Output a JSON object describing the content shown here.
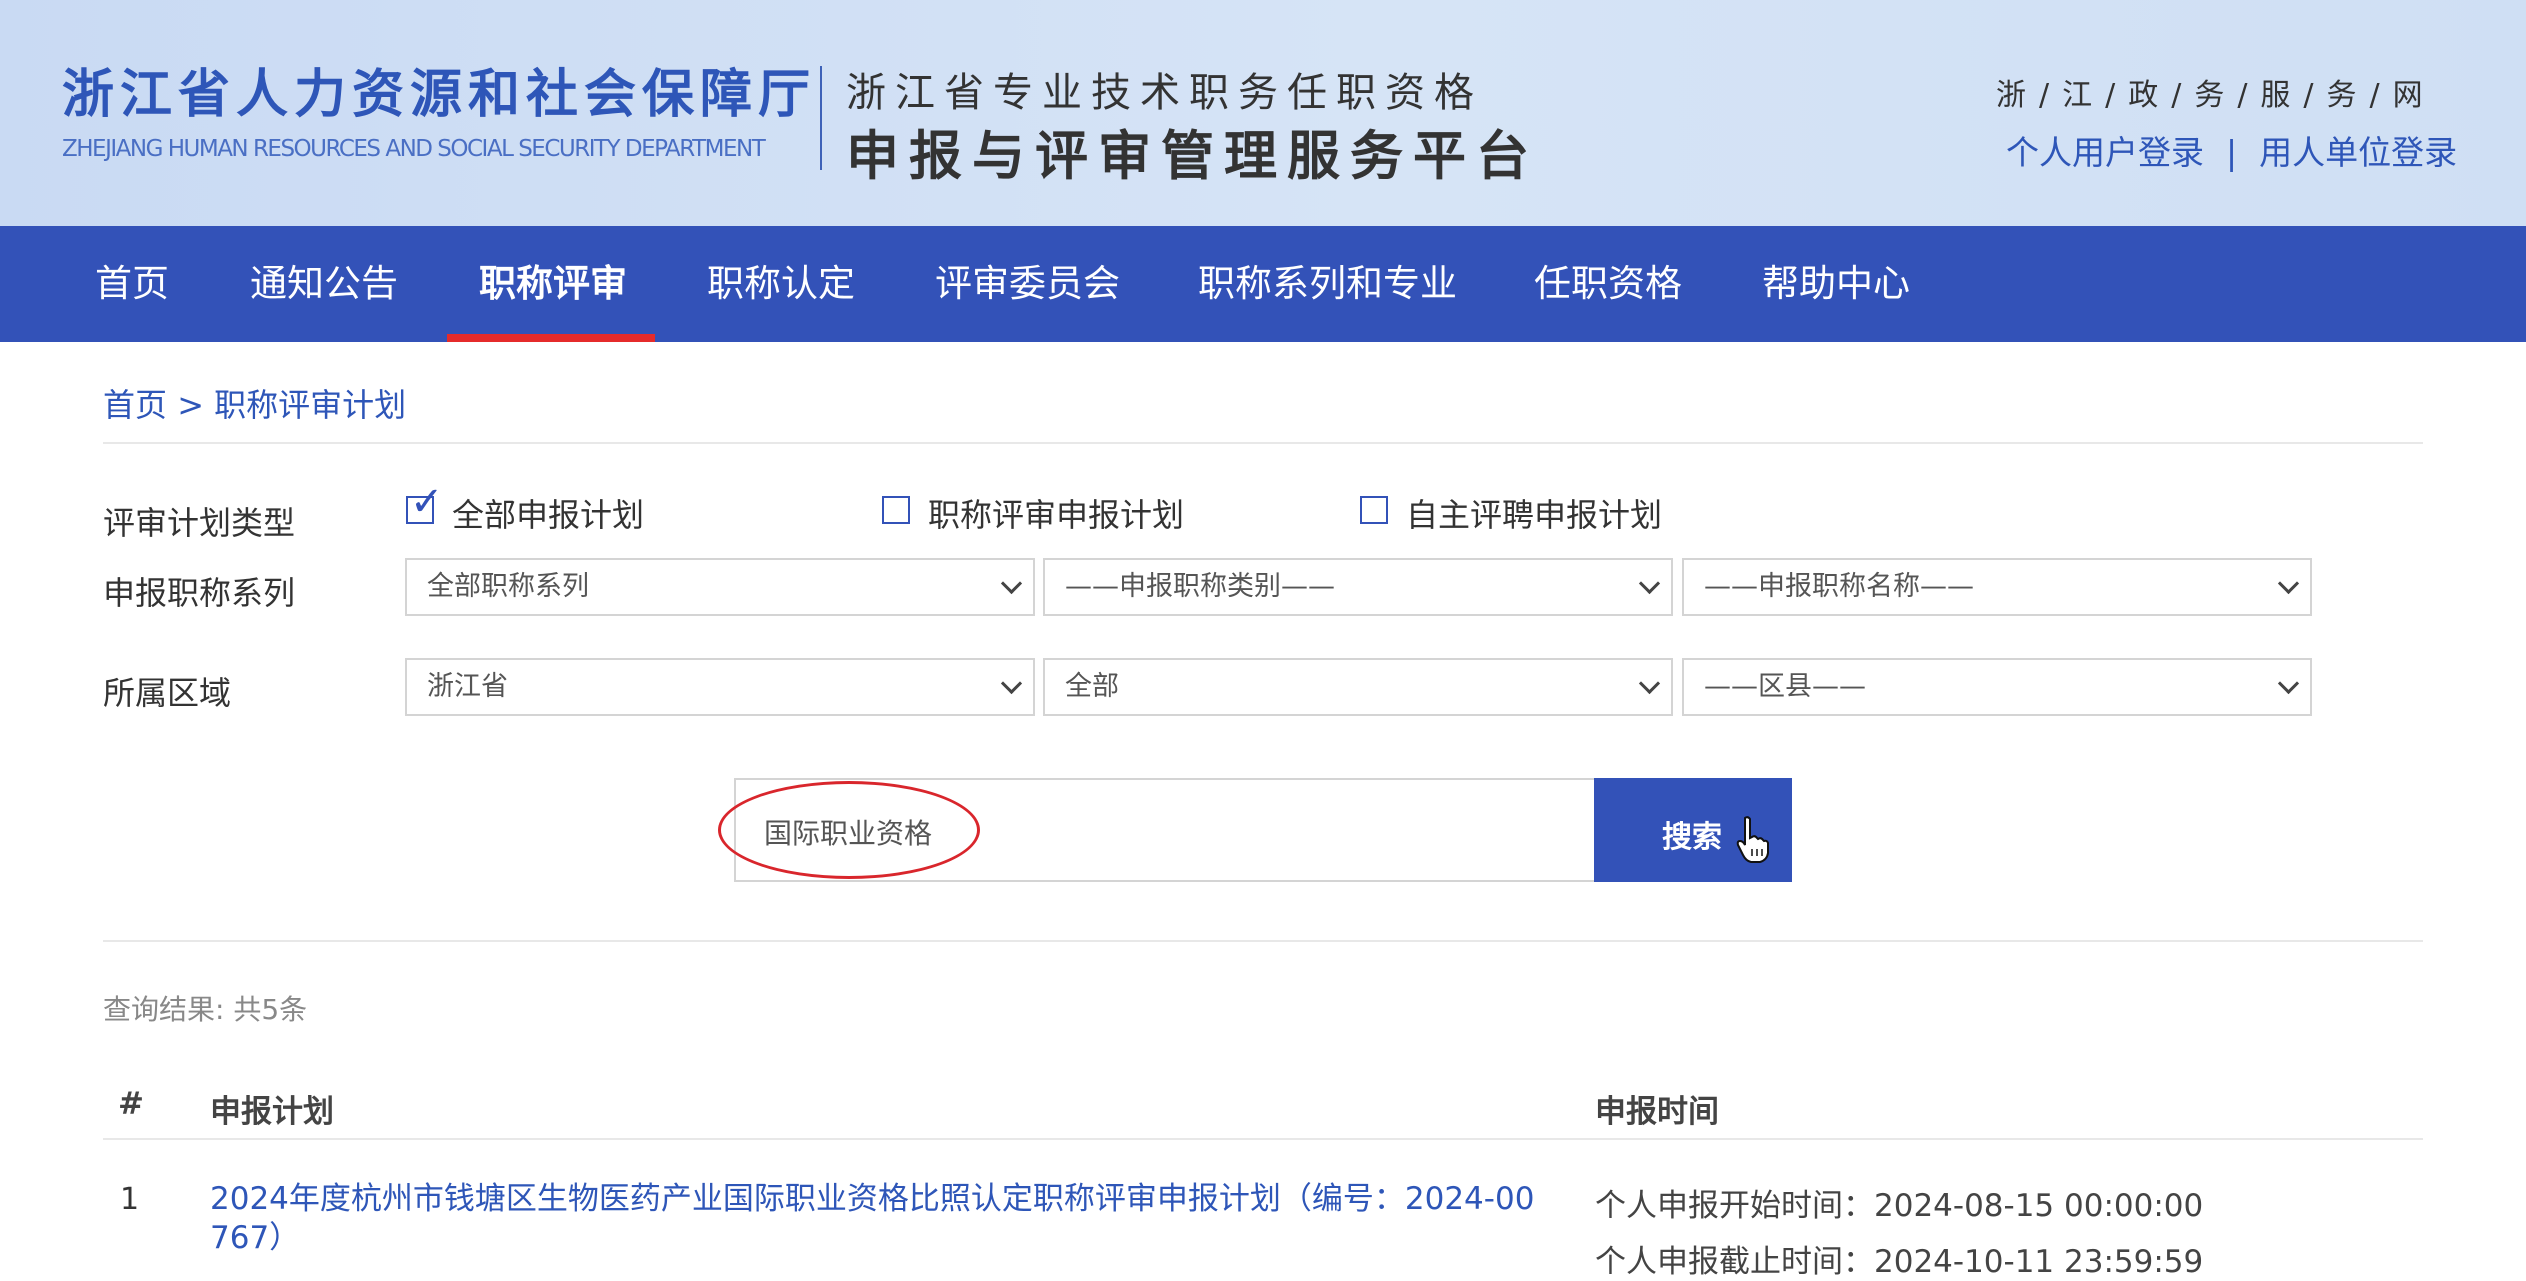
{
  "header": {
    "org_name_cn": "浙江省人力资源和社会保障厅",
    "org_name_en": "ZHEJIANG HUMAN RESOURCES AND SOCIAL SECURITY DEPARTMENT",
    "platform_subtitle": "浙江省专业技术职务任职资格",
    "platform_title": "申报与评审管理服务平台",
    "gov_portal": "浙/江/政/务/服/务/网",
    "personal_login": "个人用户登录",
    "login_separator": "|",
    "unit_login": "用人单位登录"
  },
  "nav": {
    "items": [
      {
        "label": "首页"
      },
      {
        "label": "通知公告"
      },
      {
        "label": "职称评审"
      },
      {
        "label": "职称认定"
      },
      {
        "label": "评审委员会"
      },
      {
        "label": "职称系列和专业"
      },
      {
        "label": "任职资格"
      },
      {
        "label": "帮助中心"
      }
    ],
    "active_index": 2,
    "accent_color": "#3352b8",
    "active_underline_color": "#e52b2b"
  },
  "breadcrumb": {
    "home": "首页",
    "separator": ">",
    "current": "职称评审计划"
  },
  "filters": {
    "plan_type_label": "评审计划类型",
    "plan_types": [
      {
        "label": "全部申报计划",
        "checked": true
      },
      {
        "label": "职称评审申报计划",
        "checked": false
      },
      {
        "label": "自主评聘申报计划",
        "checked": false
      }
    ],
    "series_label": "申报职称系列",
    "series_selects": [
      "全部职称系列",
      "——申报职称类别——",
      "——申报职称名称——"
    ],
    "region_label": "所属区域",
    "region_selects": [
      "浙江省",
      "全部",
      "——区县——"
    ]
  },
  "search": {
    "value": "国际职业资格",
    "button_label": "搜索",
    "cursor_icon": "hand-pointer-icon",
    "annotation_color": "#d9262c"
  },
  "results": {
    "summary": "查询结果: 共5条",
    "columns": {
      "index": "#",
      "plan": "申报计划",
      "time": "申报时间"
    },
    "rows": [
      {
        "index": "1",
        "plan": "2024年度杭州市钱塘区生物医药产业国际职业资格比照认定职称评审申报计划（编号：2024-00767）",
        "start": "个人申报开始时间：2024-08-15 00:00:00",
        "end": "个人申报截止时间：2024-10-11 23:59:59"
      }
    ]
  }
}
